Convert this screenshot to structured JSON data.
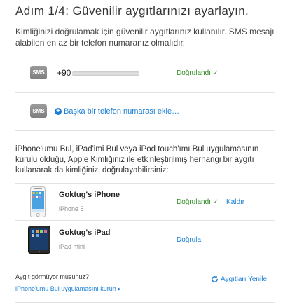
{
  "header": {
    "title": "Adım 1/4: Güvenilir aygıtlarınızı ayarlayın.",
    "intro": "Kimliğinizi doğrulamak için güvenilir aygıtlarınız kullanılır. SMS mesajı alabilen en az bir telefon numaranız olmalıdır."
  },
  "sms_badge_label": "SMS",
  "phones": {
    "number": "+90",
    "status": "Doğrulandı ✓",
    "add_label": "Başka bir telefon numarası ekle…",
    "add_icon": "plus-circle-icon"
  },
  "find_my": {
    "text": "iPhone'umu Bul, iPad'imi Bul veya iPod touch'ımı Bul uygulamasının kurulu olduğu, Apple Kimliğiniz ile etkinleştirilmiş herhangi bir aygıtı kullanarak da kimliğinizi doğrulayabilirsiniz:"
  },
  "devices": [
    {
      "name": "Goktug's iPhone",
      "model": "iPhone 5",
      "status": "Doğrulandı ✓",
      "action": "Kaldır"
    },
    {
      "name": "Goktug's iPad",
      "model": "iPad mini",
      "action": "Doğrula"
    }
  ],
  "footer": {
    "question": "Aygıt görmüyor musunuz?",
    "install_link": "iPhone'umu Bul uygulamasını kurun ▸",
    "refresh_label": "Aygıtları Yenile",
    "refresh_icon": "refresh-icon"
  },
  "colors": {
    "verified_green": "#2e8b20",
    "link_blue": "#1a7fd4"
  }
}
